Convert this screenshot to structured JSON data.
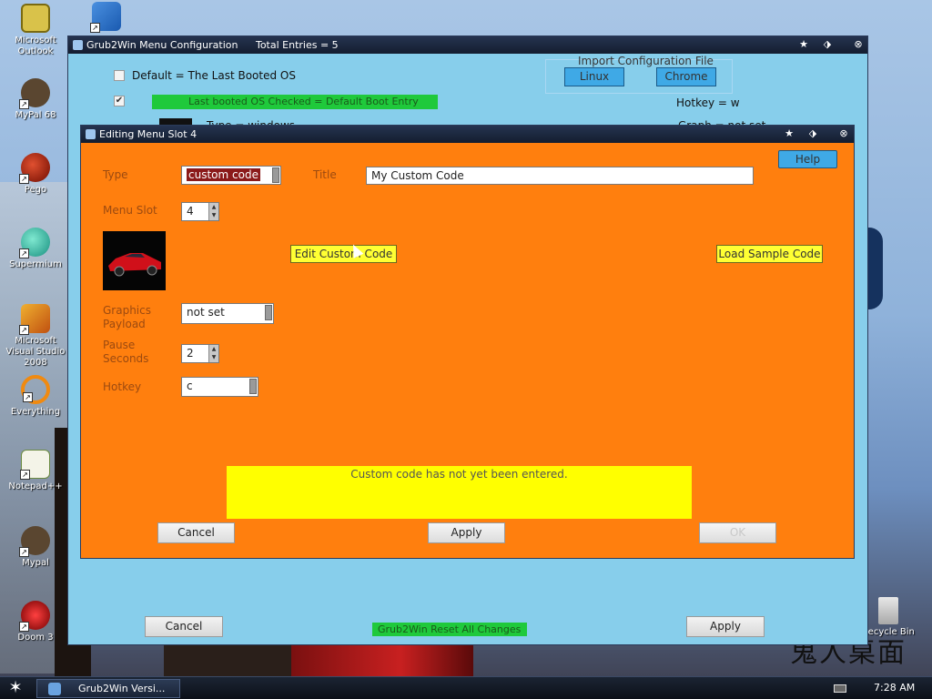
{
  "desktop": {
    "icons": [
      {
        "label": "Microsoft Outlook",
        "icon": "outlook-icon",
        "color": "#d9c24a"
      },
      {
        "label": "MyPal 68",
        "icon": "mypal-raccoon-icon",
        "color": "#5a4630"
      },
      {
        "label": "Pego",
        "icon": "pego-icon",
        "color": "#b02a10"
      },
      {
        "label": "Supermium",
        "icon": "supermium-icon",
        "color": "#28b8a0"
      },
      {
        "label": "Microsoft Visual Studio 2008",
        "icon": "visual-studio-icon",
        "color": "#e08a20"
      },
      {
        "label": "Everything",
        "icon": "everything-icon",
        "color": "#f08a10"
      },
      {
        "label": "Notepad++",
        "icon": "notepad-plus-plus-icon",
        "color": "#88c058"
      },
      {
        "label": "Mypal",
        "icon": "mypal-raccoon-icon",
        "color": "#5a4630"
      },
      {
        "label": "Doom 3",
        "icon": "doom3-icon",
        "color": "#a81818"
      }
    ],
    "recycle_bin": {
      "label": "Recycle Bin",
      "icon": "recycle-bin-icon"
    },
    "top_icon": {
      "icon": "app-shortcut-icon"
    },
    "logo_text": "鬼人桌面"
  },
  "taskbar": {
    "start_icon": "star-icon",
    "task_label": "Grub2Win  Versi...",
    "keyboard_icon": "keyboard-icon",
    "clock": "7:28 AM"
  },
  "main_window": {
    "title": "Grub2Win Menu Configuration",
    "total_entries": "Total Entries = 5",
    "default_label": "Default = The Last Booted OS",
    "check_mark": "✔",
    "green_strip_text": "Last booted OS    Checked = Default Boot Entry",
    "hotkey_text": "Hotkey = w",
    "type_text": "Type = windows",
    "graph_text": "Graph = not set",
    "import_label": "Import Configuration File",
    "import_linux": "Linux",
    "import_chrome": "Chrome",
    "cancel_label": "Cancel",
    "apply_label": "Apply",
    "bottom_green_text": "Grub2Win Reset All Changes"
  },
  "edit_dialog": {
    "title": "Editing Menu Slot 4",
    "type_label": "Type",
    "type_value": "custom code",
    "title_label": "Title",
    "title_value": "My Custom Code",
    "help_label": "Help",
    "menu_slot_label": "Menu Slot",
    "menu_slot_value": "4",
    "edit_custom_code_label": "Edit Custom Code",
    "load_sample_code_label": "Load Sample Code",
    "graphics_payload_label_1": "Graphics",
    "graphics_payload_label_2": "Payload",
    "graphics_payload_value": "not set",
    "pause_seconds_label_1": "Pause",
    "pause_seconds_label_2": "Seconds",
    "pause_seconds_value": "2",
    "hotkey_label": "Hotkey",
    "hotkey_value": "c",
    "message": "Custom code has not yet been entered.",
    "cancel_label": "Cancel",
    "apply_label": "Apply",
    "ok_label": "OK"
  },
  "colors": {
    "dialog_bg": "#ff7f0e",
    "main_bg": "#87ceeb",
    "message_bg": "#ffff00",
    "button_yellow": "#ffff33",
    "button_sky": "#3fa9e6",
    "green_strip": "#1fc93b"
  }
}
